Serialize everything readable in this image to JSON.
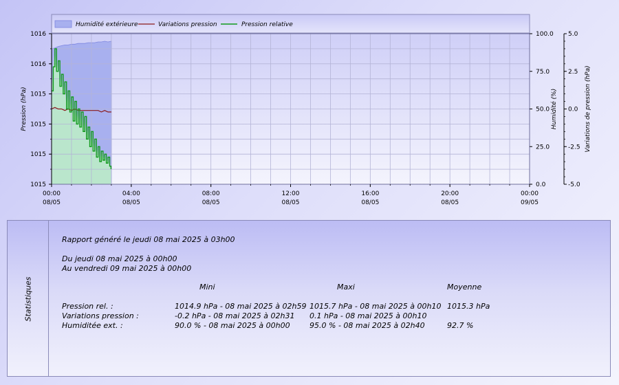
{
  "chart_data": {
    "type": "line",
    "x_range": [
      "00:00 08/05",
      "00:00 09/05"
    ],
    "x_tick_labels": [
      {
        "time": "00:00",
        "date": "08/05"
      },
      {
        "time": "04:00",
        "date": "08/05"
      },
      {
        "time": "08:00",
        "date": "08/05"
      },
      {
        "time": "12:00",
        "date": "08/05"
      },
      {
        "time": "16:00",
        "date": "08/05"
      },
      {
        "time": "20:00",
        "date": "08/05"
      },
      {
        "time": "00:00",
        "date": "09/05"
      }
    ],
    "y_left": {
      "label": "Pression (hPa)",
      "tick_labels": [
        "1016",
        "1016",
        "1015",
        "1015",
        "1015",
        "1015"
      ],
      "range": [
        1014.8,
        1015.8
      ]
    },
    "y_right1": {
      "label": "Humidité (%)",
      "ticks": [
        "100.0",
        "75.0",
        "50.0",
        "25.0",
        "0.0"
      ],
      "range": [
        0,
        100
      ]
    },
    "y_right2": {
      "label": "Variations de pression (hPa)",
      "ticks": [
        "5.0",
        "2.5",
        "0.0",
        "-2.5",
        "-5.0"
      ],
      "range": [
        -5,
        5
      ]
    },
    "legend_position": "top-left",
    "grid": true,
    "series": [
      {
        "name": "Humidité extérieure",
        "type": "area",
        "axis": "humidity",
        "color": "#a8b0ef",
        "x": [
          "00:00",
          "00:10",
          "00:20",
          "00:30",
          "00:40",
          "00:50",
          "01:00",
          "01:10",
          "01:20",
          "01:30",
          "01:40",
          "01:50",
          "02:00",
          "02:10",
          "02:20",
          "02:30",
          "02:40",
          "02:50",
          "03:00"
        ],
        "values": [
          90.0,
          90.5,
          91.5,
          92.0,
          92.5,
          92.5,
          93.0,
          93.0,
          93.5,
          93.5,
          93.5,
          94.0,
          94.0,
          94.0,
          94.5,
          94.5,
          95.0,
          94.5,
          95.0
        ]
      },
      {
        "name": "Variations pression",
        "type": "line",
        "axis": "variation",
        "color": "#8b1a1a",
        "x": [
          "00:00",
          "00:10",
          "00:20",
          "00:30",
          "00:40",
          "00:50",
          "01:00",
          "01:10",
          "01:20",
          "01:30",
          "01:40",
          "01:50",
          "02:00",
          "02:10",
          "02:20",
          "02:30",
          "02:40",
          "02:50",
          "03:00"
        ],
        "values": [
          0.0,
          0.1,
          0.0,
          0.0,
          -0.1,
          0.0,
          -0.1,
          0.0,
          -0.1,
          -0.1,
          -0.1,
          -0.1,
          -0.1,
          -0.1,
          -0.1,
          -0.2,
          -0.1,
          -0.2,
          -0.2
        ]
      },
      {
        "name": "Pression relative",
        "type": "line",
        "axis": "pressure",
        "color": "#119a1c",
        "x": [
          "00:00",
          "00:05",
          "00:10",
          "00:15",
          "00:20",
          "00:25",
          "00:30",
          "00:35",
          "00:40",
          "00:45",
          "00:50",
          "00:55",
          "01:00",
          "01:05",
          "01:10",
          "01:15",
          "01:20",
          "01:25",
          "01:30",
          "01:35",
          "01:40",
          "01:45",
          "01:50",
          "01:55",
          "02:00",
          "02:05",
          "02:10",
          "02:15",
          "02:20",
          "02:25",
          "02:30",
          "02:35",
          "02:40",
          "02:45",
          "02:50",
          "02:55",
          "02:59"
        ],
        "values": [
          1015.42,
          1015.58,
          1015.7,
          1015.55,
          1015.62,
          1015.45,
          1015.53,
          1015.4,
          1015.48,
          1015.3,
          1015.42,
          1015.28,
          1015.38,
          1015.22,
          1015.35,
          1015.2,
          1015.3,
          1015.18,
          1015.28,
          1015.15,
          1015.25,
          1015.1,
          1015.18,
          1015.05,
          1015.15,
          1015.02,
          1015.1,
          1014.98,
          1015.05,
          1014.95,
          1015.02,
          1014.96,
          1015.0,
          1014.94,
          1014.98,
          1014.92,
          1014.9
        ]
      }
    ],
    "fill_colors": {
      "pressure_fill": "#bdf0c6"
    }
  },
  "stats": {
    "panel_label": "Statistiques",
    "report_line": "Rapport généré le jeudi 08 mai 2025 à 03h00",
    "from_line": "Du jeudi 08 mai 2025 à 00h00",
    "to_line": "Au vendredi 09 mai 2025 à 00h00",
    "headers": {
      "min": "Mini",
      "max": "Maxi",
      "avg": "Moyenne"
    },
    "rows": [
      {
        "label": "Pression rel. :",
        "min": "1014.9 hPa - 08 mai 2025 à 02h59",
        "max": "1015.7 hPa - 08 mai 2025 à 00h10",
        "avg": "1015.3 hPa"
      },
      {
        "label": "Variations pression :",
        "min": "-0.2 hPa - 08 mai 2025 à 02h31",
        "max": "0.1 hPa - 08 mai 2025 à 00h10",
        "avg": ""
      },
      {
        "label": "Humiditée ext. :",
        "min": "90.0 % - 08 mai 2025 à 00h00",
        "max": "95.0 % - 08 mai 2025 à 02h40",
        "avg": "92.7 %"
      }
    ]
  }
}
